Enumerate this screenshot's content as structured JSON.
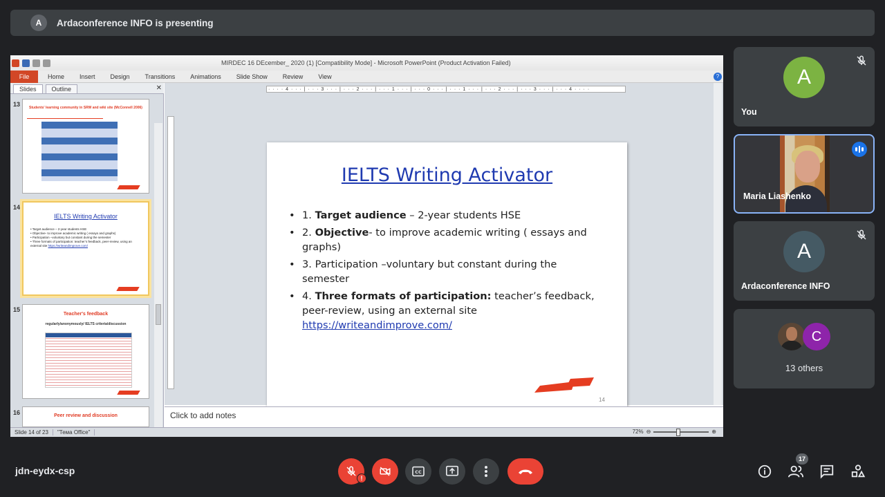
{
  "banner": {
    "avatar_letter": "A",
    "text": "Ardaconference INFO is presenting"
  },
  "ppt": {
    "window_title": "MIRDEC 16 DEcember_ 2020 (1) [Compatibility Mode] - Microsoft PowerPoint (Product Activation Failed)",
    "ribbon_tabs": [
      "File",
      "Home",
      "Insert",
      "Design",
      "Transitions",
      "Animations",
      "Slide Show",
      "Review",
      "View"
    ],
    "pane_tabs": [
      "Slides",
      "Outline"
    ],
    "ruler_text": "· · · · 4 · · · | · · · 3 · · · | · · · 2 · · · | · · · 1 · · · | · · · 0 · · · | · · · 1 · · · | · · · 2 · · · | · · · 3 · · · | · · · 4 · · · ·",
    "thumbnails": [
      {
        "num": "13",
        "title": "Students' learning community in SRW and wiki site (McConnell 2006)",
        "selected": false
      },
      {
        "num": "14",
        "title": "IELTS Writing Activator",
        "selected": true
      },
      {
        "num": "15",
        "title": "Teacher's feedback",
        "subtitle": "regularly/anonymously/ IELTS criteria/discussion",
        "selected": false
      },
      {
        "num": "16",
        "title": "Peer review and discussion",
        "selected": false
      }
    ],
    "slide": {
      "title": "IELTS Writing Activator",
      "bullets": [
        {
          "prefix": "1. ",
          "bold": "Target audience",
          "rest": " – 2-year students HSE"
        },
        {
          "prefix": "2. ",
          "bold": "Objective",
          "rest": "- to improve academic writing ( essays and graphs)"
        },
        {
          "prefix": "3. ",
          "bold": "",
          "rest": "Participation –voluntary but constant during the semester"
        },
        {
          "prefix": "4.  ",
          "bold": "Three formats of participation:",
          "rest": "  teacher’s feedback, peer-review,  using an external site ",
          "link": "https://writeandimprove.com/"
        }
      ],
      "number": "14"
    },
    "notes_placeholder": "Click to add notes",
    "status": {
      "slide_info": "Slide 14 of 23",
      "theme": "\"Тема Office\"",
      "zoom": "72%"
    }
  },
  "participants": [
    {
      "name": "You",
      "avatar_letter": "A",
      "avatar_color": "#7cb342",
      "muted": true
    },
    {
      "name": "Maria Liashenko",
      "speaking": true
    },
    {
      "name": "Ardaconference INFO",
      "avatar_letter": "A",
      "avatar_color": "#455a64",
      "muted": true
    },
    {
      "name": "13 others",
      "avatar_letter": "C",
      "avatar_color": "#8e24aa"
    }
  ],
  "meeting": {
    "code": "jdn-eydx-csp",
    "participant_count": "17"
  },
  "colors": {
    "accent_blue": "#1a73e8",
    "danger": "#ea4335",
    "bg": "#202124",
    "tile": "#3c4043"
  }
}
